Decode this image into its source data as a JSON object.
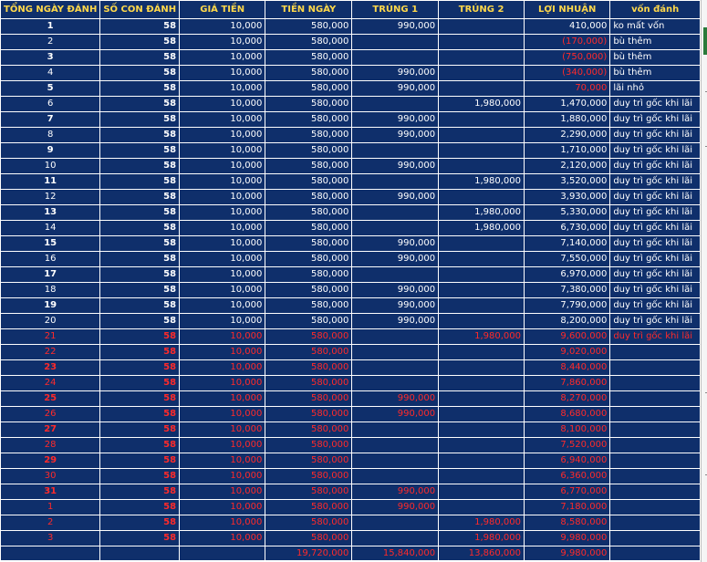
{
  "headers": [
    "TỔNG NGÀY ĐÁNH",
    "SỐ CON ĐÁNH",
    "GIÁ TIỀN",
    "TIỀN NGÀY",
    "TRÚNG 1",
    "TRÚNG 2",
    "LỢI NHUẬN",
    "vốn đánh"
  ],
  "rows": [
    {
      "day": "1",
      "so": "58",
      "gia": "10,000",
      "tien": "580,000",
      "t1": "990,000",
      "t2": "",
      "ln": "410,000",
      "note": "ko mất vốn",
      "style": "white",
      "neg": false,
      "bold": true
    },
    {
      "day": "2",
      "so": "58",
      "gia": "10,000",
      "tien": "580,000",
      "t1": "",
      "t2": "",
      "ln": "(170,000)",
      "note": "bù thêm",
      "style": "white",
      "neg": true,
      "bold": false
    },
    {
      "day": "3",
      "so": "58",
      "gia": "10,000",
      "tien": "580,000",
      "t1": "",
      "t2": "",
      "ln": "(750,000)",
      "note": "bù thêm",
      "style": "white",
      "neg": true,
      "bold": true
    },
    {
      "day": "4",
      "so": "58",
      "gia": "10,000",
      "tien": "580,000",
      "t1": "990,000",
      "t2": "",
      "ln": "(340,000)",
      "note": "bù thêm",
      "style": "white",
      "neg": true,
      "bold": false
    },
    {
      "day": "5",
      "so": "58",
      "gia": "10,000",
      "tien": "580,000",
      "t1": "990,000",
      "t2": "",
      "ln": "70,000",
      "note": "lãi nhỏ",
      "style": "white",
      "neg": true,
      "bold": true
    },
    {
      "day": "6",
      "so": "58",
      "gia": "10,000",
      "tien": "580,000",
      "t1": "",
      "t2": "1,980,000",
      "ln": "1,470,000",
      "note": "duy trì gốc khi lãi",
      "style": "white",
      "neg": false,
      "bold": false
    },
    {
      "day": "7",
      "so": "58",
      "gia": "10,000",
      "tien": "580,000",
      "t1": "990,000",
      "t2": "",
      "ln": "1,880,000",
      "note": "duy trì gốc khi lãi",
      "style": "white",
      "neg": false,
      "bold": true
    },
    {
      "day": "8",
      "so": "58",
      "gia": "10,000",
      "tien": "580,000",
      "t1": "990,000",
      "t2": "",
      "ln": "2,290,000",
      "note": "duy trì gốc khi lãi",
      "style": "white",
      "neg": false,
      "bold": false
    },
    {
      "day": "9",
      "so": "58",
      "gia": "10,000",
      "tien": "580,000",
      "t1": "",
      "t2": "",
      "ln": "1,710,000",
      "note": "duy trì gốc khi lãi",
      "style": "white",
      "neg": false,
      "bold": true
    },
    {
      "day": "10",
      "so": "58",
      "gia": "10,000",
      "tien": "580,000",
      "t1": "990,000",
      "t2": "",
      "ln": "2,120,000",
      "note": "duy trì gốc khi lãi",
      "style": "white",
      "neg": false,
      "bold": false
    },
    {
      "day": "11",
      "so": "58",
      "gia": "10,000",
      "tien": "580,000",
      "t1": "",
      "t2": "1,980,000",
      "ln": "3,520,000",
      "note": "duy trì gốc khi lãi",
      "style": "white",
      "neg": false,
      "bold": true
    },
    {
      "day": "12",
      "so": "58",
      "gia": "10,000",
      "tien": "580,000",
      "t1": "990,000",
      "t2": "",
      "ln": "3,930,000",
      "note": "duy trì gốc khi lãi",
      "style": "white",
      "neg": false,
      "bold": false
    },
    {
      "day": "13",
      "so": "58",
      "gia": "10,000",
      "tien": "580,000",
      "t1": "",
      "t2": "1,980,000",
      "ln": "5,330,000",
      "note": "duy trì gốc khi lãi",
      "style": "white",
      "neg": false,
      "bold": true
    },
    {
      "day": "14",
      "so": "58",
      "gia": "10,000",
      "tien": "580,000",
      "t1": "",
      "t2": "1,980,000",
      "ln": "6,730,000",
      "note": "duy trì gốc khi lãi",
      "style": "white",
      "neg": false,
      "bold": false
    },
    {
      "day": "15",
      "so": "58",
      "gia": "10,000",
      "tien": "580,000",
      "t1": "990,000",
      "t2": "",
      "ln": "7,140,000",
      "note": "duy trì gốc khi lãi",
      "style": "white",
      "neg": false,
      "bold": true
    },
    {
      "day": "16",
      "so": "58",
      "gia": "10,000",
      "tien": "580,000",
      "t1": "990,000",
      "t2": "",
      "ln": "7,550,000",
      "note": "duy trì gốc khi lãi",
      "style": "white",
      "neg": false,
      "bold": false
    },
    {
      "day": "17",
      "so": "58",
      "gia": "10,000",
      "tien": "580,000",
      "t1": "",
      "t2": "",
      "ln": "6,970,000",
      "note": "duy trì gốc khi lãi",
      "style": "white",
      "neg": false,
      "bold": true
    },
    {
      "day": "18",
      "so": "58",
      "gia": "10,000",
      "tien": "580,000",
      "t1": "990,000",
      "t2": "",
      "ln": "7,380,000",
      "note": "duy trì gốc khi lãi",
      "style": "white",
      "neg": false,
      "bold": false
    },
    {
      "day": "19",
      "so": "58",
      "gia": "10,000",
      "tien": "580,000",
      "t1": "990,000",
      "t2": "",
      "ln": "7,790,000",
      "note": "duy trì gốc khi lãi",
      "style": "white",
      "neg": false,
      "bold": true
    },
    {
      "day": "20",
      "so": "58",
      "gia": "10,000",
      "tien": "580,000",
      "t1": "990,000",
      "t2": "",
      "ln": "8,200,000",
      "note": "duy trì gốc khi lãi",
      "style": "white",
      "neg": false,
      "bold": false
    },
    {
      "day": "21",
      "so": "58",
      "gia": "10,000",
      "tien": "580,000",
      "t1": "",
      "t2": "1,980,000",
      "ln": "9,600,000",
      "note": "duy trì gốc khi lãi",
      "style": "red",
      "neg": false,
      "bold": false
    },
    {
      "day": "22",
      "so": "58",
      "gia": "10,000",
      "tien": "580,000",
      "t1": "",
      "t2": "",
      "ln": "9,020,000",
      "note": "",
      "style": "red",
      "neg": false,
      "bold": false
    },
    {
      "day": "23",
      "so": "58",
      "gia": "10,000",
      "tien": "580,000",
      "t1": "",
      "t2": "",
      "ln": "8,440,000",
      "note": "",
      "style": "red",
      "neg": false,
      "bold": true
    },
    {
      "day": "24",
      "so": "58",
      "gia": "10,000",
      "tien": "580,000",
      "t1": "",
      "t2": "",
      "ln": "7,860,000",
      "note": "",
      "style": "red",
      "neg": false,
      "bold": false
    },
    {
      "day": "25",
      "so": "58",
      "gia": "10,000",
      "tien": "580,000",
      "t1": "990,000",
      "t2": "",
      "ln": "8,270,000",
      "note": "",
      "style": "red",
      "neg": false,
      "bold": true
    },
    {
      "day": "26",
      "so": "58",
      "gia": "10,000",
      "tien": "580,000",
      "t1": "990,000",
      "t2": "",
      "ln": "8,680,000",
      "note": "",
      "style": "red",
      "neg": false,
      "bold": false
    },
    {
      "day": "27",
      "so": "58",
      "gia": "10,000",
      "tien": "580,000",
      "t1": "",
      "t2": "",
      "ln": "8,100,000",
      "note": "",
      "style": "red",
      "neg": false,
      "bold": true
    },
    {
      "day": "28",
      "so": "58",
      "gia": "10,000",
      "tien": "580,000",
      "t1": "",
      "t2": "",
      "ln": "7,520,000",
      "note": "",
      "style": "red",
      "neg": false,
      "bold": false
    },
    {
      "day": "29",
      "so": "58",
      "gia": "10,000",
      "tien": "580,000",
      "t1": "",
      "t2": "",
      "ln": "6,940,000",
      "note": "",
      "style": "red",
      "neg": false,
      "bold": true
    },
    {
      "day": "30",
      "so": "58",
      "gia": "10,000",
      "tien": "580,000",
      "t1": "",
      "t2": "",
      "ln": "6,360,000",
      "note": "",
      "style": "red",
      "neg": false,
      "bold": false
    },
    {
      "day": "31",
      "so": "58",
      "gia": "10,000",
      "tien": "580,000",
      "t1": "990,000",
      "t2": "",
      "ln": "6,770,000",
      "note": "",
      "style": "red",
      "neg": false,
      "bold": true
    },
    {
      "day": "1",
      "so": "58",
      "gia": "10,000",
      "tien": "580,000",
      "t1": "990,000",
      "t2": "",
      "ln": "7,180,000",
      "note": "",
      "style": "red",
      "neg": false,
      "bold": false
    },
    {
      "day": "2",
      "so": "58",
      "gia": "10,000",
      "tien": "580,000",
      "t1": "",
      "t2": "1,980,000",
      "ln": "8,580,000",
      "note": "",
      "style": "red",
      "neg": false,
      "bold": false
    },
    {
      "day": "3",
      "so": "58",
      "gia": "10,000",
      "tien": "580,000",
      "t1": "",
      "t2": "1,980,000",
      "ln": "9,980,000",
      "note": "",
      "style": "red",
      "neg": false,
      "bold": false
    }
  ],
  "totals": {
    "tien": "19,720,000",
    "t1": "15,840,000",
    "t2": "13,860,000",
    "ln": "9,980,000"
  },
  "colors": {
    "sheet_bg": "#0f2f6b",
    "header_text": "#ffd84a",
    "red_text": "#ff2a2a",
    "white_text": "#ffffff"
  }
}
